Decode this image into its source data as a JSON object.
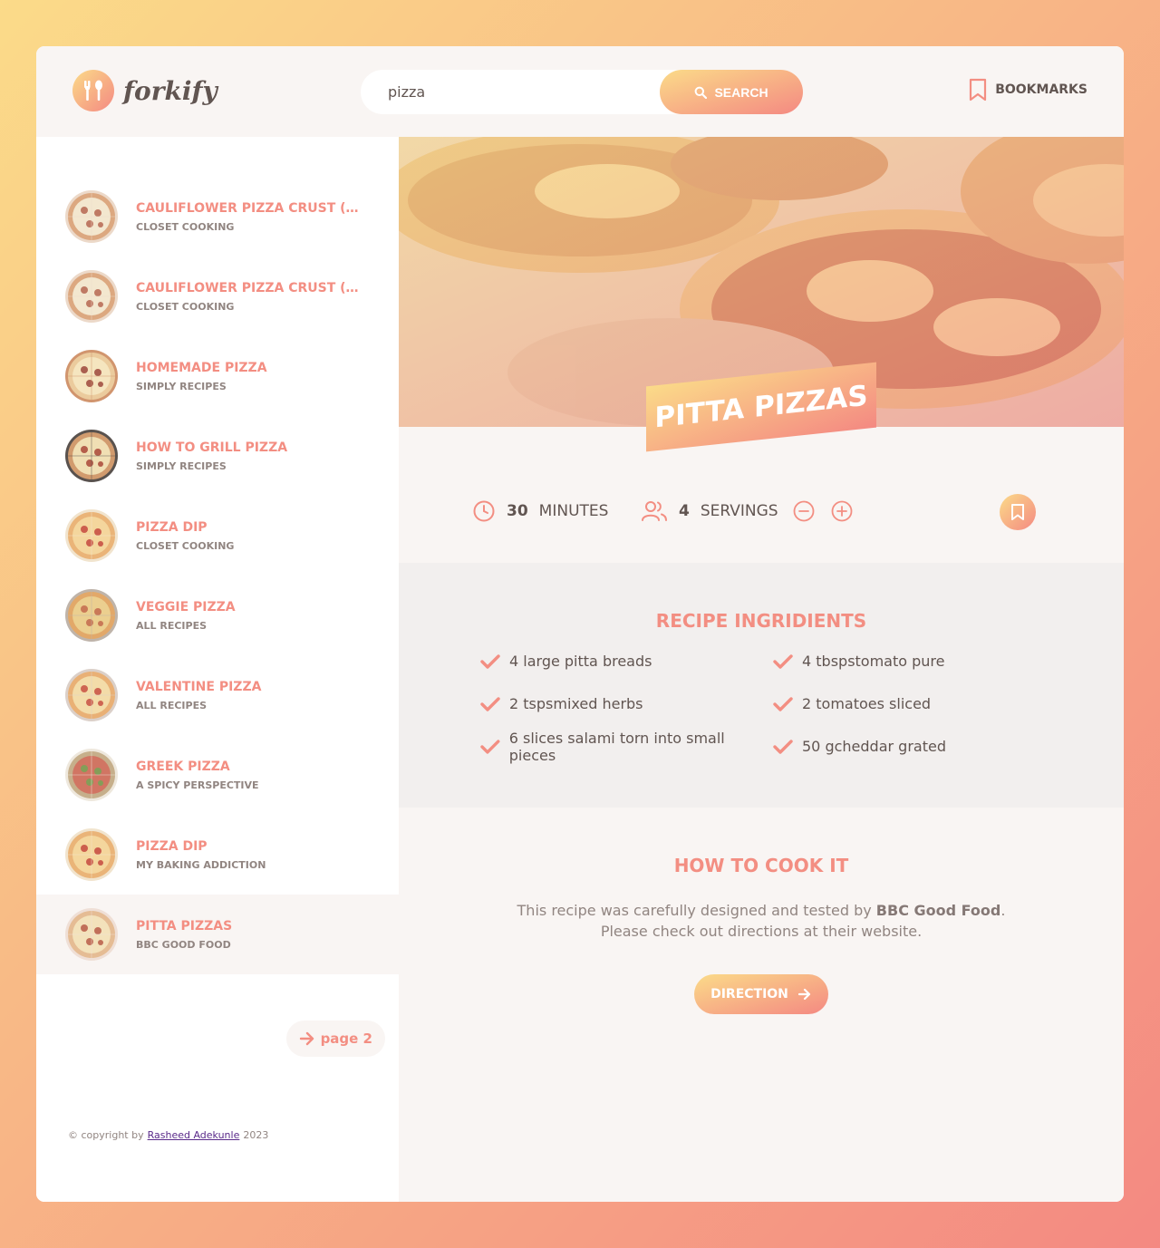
{
  "header": {
    "logo_text": "forkify",
    "search": {
      "value": "pizza",
      "button_label": "Search"
    },
    "bookmarks_label": "Bookmarks"
  },
  "results": [
    {
      "title": "Cauliflower Pizza Crust (with BBQ Chicken Pizza)",
      "publisher": "Closet Cooking",
      "thumb": "slices"
    },
    {
      "title": "Cauliflower Pizza Crust (with BBQ Chicken Pizza)",
      "publisher": "Closet Cooking",
      "thumb": "slices"
    },
    {
      "title": "Homemade Pizza",
      "publisher": "Simply Recipes",
      "thumb": "pizza"
    },
    {
      "title": "How to Grill Pizza",
      "publisher": "Simply Recipes",
      "thumb": "grill"
    },
    {
      "title": "Pizza Dip",
      "publisher": "Closet Cooking",
      "thumb": "pepperoni"
    },
    {
      "title": "Veggie Pizza",
      "publisher": "All Recipes",
      "thumb": "veggie"
    },
    {
      "title": "Valentine Pizza",
      "publisher": "All Recipes",
      "thumb": "valentine"
    },
    {
      "title": "Greek Pizza",
      "publisher": "A Spicy Perspective",
      "thumb": "greek"
    },
    {
      "title": "Pizza Dip",
      "publisher": "My Baking Addiction",
      "thumb": "pepperoni"
    },
    {
      "title": "Pitta Pizzas",
      "publisher": "BBC Good Food",
      "thumb": "pitta",
      "active": true
    }
  ],
  "pagination": {
    "next_label": "page 2"
  },
  "copyright": {
    "prefix": "© copyright by",
    "author": "Rasheed Adekunle",
    "year": "2023"
  },
  "recipe": {
    "title": "Pitta Pizzas",
    "cooking_time": "30",
    "cooking_time_unit": "minutes",
    "servings": "4",
    "servings_unit": "servings",
    "ingredients_heading": "Recipe ingridients",
    "ingredients": [
      "4 large pitta breads",
      "4 tbspstomato pure",
      "2 tspsmixed herbs",
      "2 tomatoes sliced",
      "6 slices salami torn into small pieces",
      "50 gcheddar grated"
    ],
    "directions_heading": "How to cook it",
    "directions_prefix": "This recipe was carefully designed and tested by ",
    "publisher": "BBC Good Food",
    "directions_suffix": ". Please check out directions at their website.",
    "direction_button_label": "Direction"
  },
  "colors": {
    "primary": "#f38e82",
    "grad_start": "#fbdb89",
    "grad_end": "#f48982",
    "text": "#615551"
  }
}
